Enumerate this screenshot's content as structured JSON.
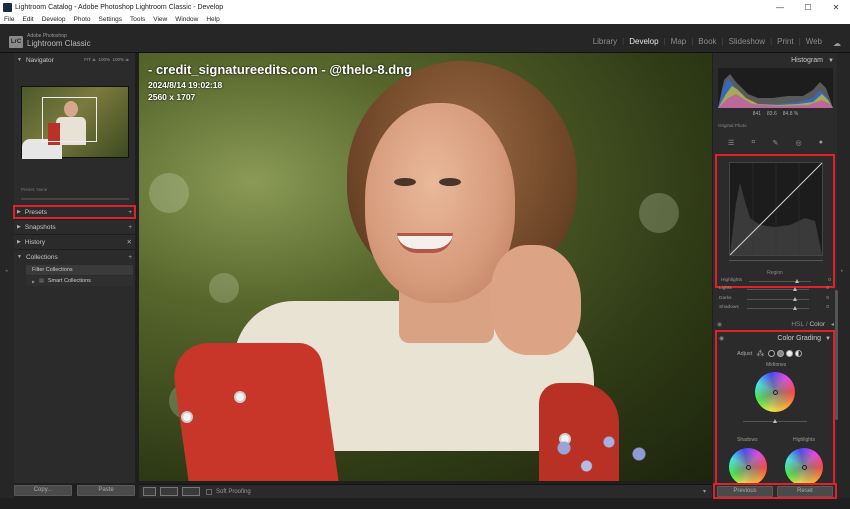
{
  "window": {
    "title": "Lightroom Catalog - Adobe Photoshop Lightroom Classic - Develop",
    "controls": [
      "—",
      "☐",
      "✕"
    ]
  },
  "menu": [
    "File",
    "Edit",
    "Develop",
    "Photo",
    "Settings",
    "Tools",
    "View",
    "Window",
    "Help"
  ],
  "brand": {
    "logo": "LrC",
    "line1": "Adobe Photoshop",
    "line2": "Lightroom Classic"
  },
  "modules": [
    {
      "label": "Library",
      "active": false
    },
    {
      "label": "Develop",
      "active": true
    },
    {
      "label": "Map",
      "active": false
    },
    {
      "label": "Book",
      "active": false
    },
    {
      "label": "Slideshow",
      "active": false
    },
    {
      "label": "Print",
      "active": false
    },
    {
      "label": "Web",
      "active": false
    }
  ],
  "left": {
    "navigator": {
      "label": "Navigator",
      "zoom": [
        "FIT ≑",
        "100%",
        "100% ≑"
      ]
    },
    "preset_line": "Preset: None",
    "presets": {
      "label": "Presets",
      "action": "+"
    },
    "snapshots": {
      "label": "Snapshots",
      "action": "+"
    },
    "history": {
      "label": "History",
      "action": "✕"
    },
    "collections": {
      "label": "Collections",
      "action": "+"
    },
    "collection_items": [
      "Filter Collections",
      "Smart Collections"
    ],
    "copy_btn": "Copy...",
    "paste_btn": "Paste"
  },
  "photo": {
    "overlay_name": "- credit_signatureedits.com - @thelo-8.dng",
    "overlay_date": "2024/8/14 19:02:18",
    "overlay_size": "2560 x 1707"
  },
  "toolbar": {
    "soft_proofing": "Soft Proofing",
    "menu_arrow": "▾"
  },
  "right": {
    "histogram": {
      "label": "Histogram",
      "values": [
        "841",
        "83.6",
        "84.8 %"
      ],
      "original": "Original Photo"
    },
    "tone_curve": {
      "region": "Region",
      "sliders": [
        {
          "label": "Highlights",
          "value": "0",
          "pos": 0.75
        },
        {
          "label": "Lights",
          "value": "0",
          "pos": 0.75
        },
        {
          "label": "Darks",
          "value": "0",
          "pos": 0.75
        },
        {
          "label": "Shadows",
          "value": "0",
          "pos": 0.75
        }
      ]
    },
    "hsl": {
      "label1": "HSL",
      "sep": "/",
      "label2": "Color"
    },
    "color_grading": {
      "label": "Color Grading",
      "adjust": "Adjust",
      "midtones": "Midtones",
      "shadows": "Shadows",
      "highlights": "Highlights"
    },
    "previous_btn": "Previous",
    "reset_btn": "Reset"
  },
  "colors": {
    "highlight_box": "#e0202a",
    "panel": "#2b2b2b",
    "active_module": "#e6e6e6"
  }
}
